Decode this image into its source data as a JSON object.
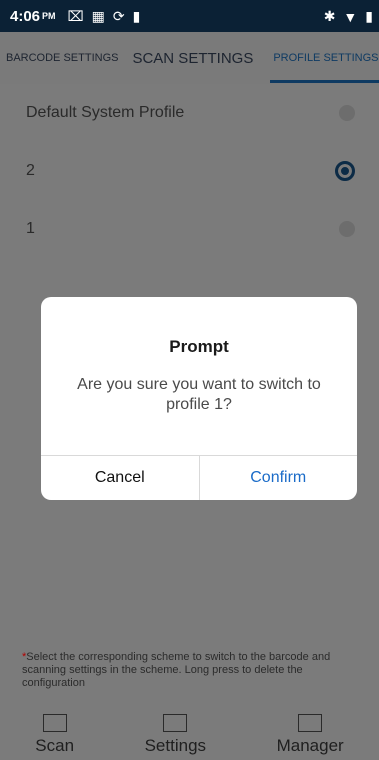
{
  "status": {
    "time": "4:06",
    "ampm": "PM",
    "left_icons": [
      "cast-icon",
      "barcode-icon",
      "sync-icon",
      "sd-card-icon"
    ],
    "right_icons": [
      "bluetooth-icon",
      "wifi-icon",
      "battery-icon"
    ]
  },
  "tabs": [
    {
      "label": "BARCODE SETTINGS"
    },
    {
      "label": "SCAN SETTINGS"
    },
    {
      "label": "PROFILE SETTINGS"
    }
  ],
  "profiles": [
    {
      "name": "Default System Profile",
      "selected": false
    },
    {
      "name": "2",
      "selected": true
    },
    {
      "name": "1",
      "selected": false
    }
  ],
  "hint": {
    "asterisk": "*",
    "text": "Select the corresponding scheme to switch to the barcode and scanning settings in the scheme. Long press to delete the configuration"
  },
  "bottom_nav": [
    {
      "label": "Scan",
      "icon": "barcode-icon"
    },
    {
      "label": "Settings",
      "icon": "qr-icon"
    },
    {
      "label": "Manager",
      "icon": "profile-card-icon"
    }
  ],
  "dialog": {
    "title": "Prompt",
    "message": "Are you sure you want to switch to profile 1?",
    "cancel": "Cancel",
    "confirm": "Confirm"
  }
}
